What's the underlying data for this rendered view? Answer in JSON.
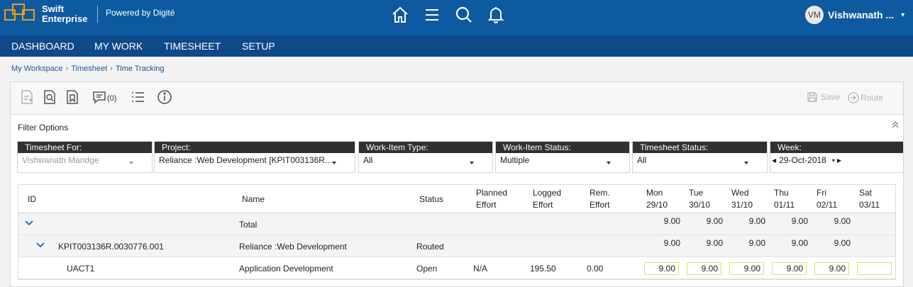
{
  "brand": {
    "line1": "Swift",
    "line2": "Enterprise",
    "powered": "Powered by Digité"
  },
  "header": {
    "icons": [
      "home-icon",
      "menu-icon",
      "search-icon",
      "bell-icon"
    ],
    "user_initials": "VM",
    "user_name": "Vishwanath ..."
  },
  "nav": [
    "DASHBOARD",
    "MY WORK",
    "TIMESHEET",
    "SETUP"
  ],
  "breadcrumb": [
    "My Workspace",
    "Timesheet",
    "Time Tracking"
  ],
  "toolbar": {
    "comment_count": "(0)",
    "save": "Save",
    "route": "Route"
  },
  "filters": {
    "title": "Filter Options",
    "items": [
      {
        "label": "Timesheet For:",
        "value": "Vishwanath Mandge"
      },
      {
        "label": "Project:",
        "value": "Reliance :Web Development [KPIT003136R..."
      },
      {
        "label": "Work-Item Type:",
        "value": "All"
      },
      {
        "label": "Work-Item Status:",
        "value": "Multiple"
      },
      {
        "label": "Timesheet Status:",
        "value": "All"
      },
      {
        "label": "Week:",
        "value": "29-Oct-2018"
      }
    ]
  },
  "grid": {
    "headers": {
      "id": "ID",
      "name": "Name",
      "status": "Status",
      "planned_1": "Planned",
      "planned_2": "Effort",
      "logged_1": "Logged",
      "logged_2": "Effort",
      "rem_1": "Rem.",
      "rem_2": "Effort",
      "days": [
        {
          "d": "Mon",
          "date": "29/10"
        },
        {
          "d": "Tue",
          "date": "30/10"
        },
        {
          "d": "Wed",
          "date": "31/10"
        },
        {
          "d": "Thu",
          "date": "01/11"
        },
        {
          "d": "Fri",
          "date": "02/11"
        },
        {
          "d": "Sat",
          "date": "03/11"
        }
      ]
    },
    "total": {
      "name": "Total",
      "days": [
        "9.00",
        "9.00",
        "9.00",
        "9.00",
        "9.00"
      ]
    },
    "group": {
      "id": "KPIT003136R.0030776.001",
      "name": "Reliance :Web Development",
      "status": "Routed",
      "days": [
        "9.00",
        "9.00",
        "9.00",
        "9.00",
        "9.00"
      ]
    },
    "item": {
      "id": "UACT1",
      "name": "Application Development",
      "status": "Open",
      "planned": "N/A",
      "logged": "195.50",
      "rem": "0.00",
      "days": [
        "9.00",
        "9.00",
        "9.00",
        "9.00",
        "9.00",
        ""
      ]
    }
  }
}
